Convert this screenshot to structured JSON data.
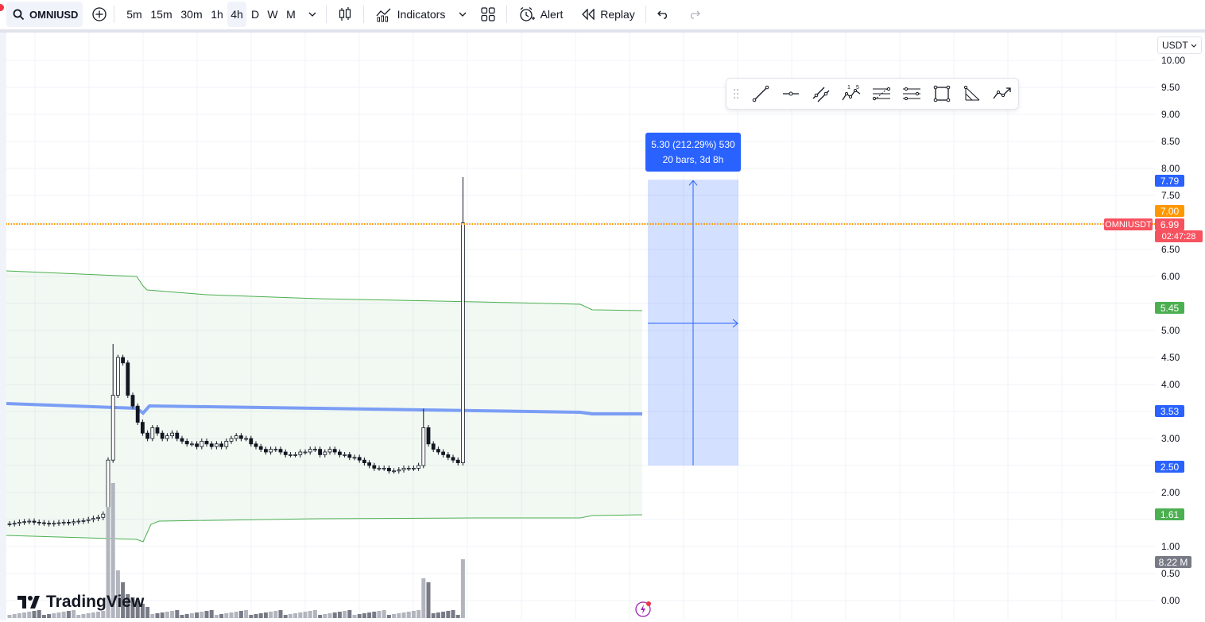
{
  "toolbar": {
    "symbol": "OMNIUSD",
    "intervals": [
      "5m",
      "15m",
      "30m",
      "1h",
      "4h",
      "D",
      "W",
      "M"
    ],
    "active_interval": "4h",
    "indicators_label": "Indicators",
    "alert_label": "Alert",
    "replay_label": "Replay"
  },
  "price_axis": {
    "currency": "USDT",
    "labels": [
      "10.00",
      "9.50",
      "9.00",
      "8.50",
      "8.00",
      "7.50",
      "6.50",
      "6.00",
      "5.00",
      "4.50",
      "4.00",
      "3.00",
      "2.00",
      "1.00",
      "0.50",
      "0.00"
    ],
    "tags": [
      {
        "value": "7.79",
        "color": "#2962ff"
      },
      {
        "value": "7.00",
        "color": "#ff9800"
      },
      {
        "value": "6.99",
        "color": "#f7525f"
      },
      {
        "value": "5.45",
        "color": "#4caf50"
      },
      {
        "value": "3.53",
        "color": "#2962ff"
      },
      {
        "value": "2.50",
        "color": "#2962ff"
      },
      {
        "value": "1.61",
        "color": "#4caf50"
      },
      {
        "value": "8.22 M",
        "color": "#787b86"
      }
    ],
    "countdown": "02:47:28"
  },
  "symbol_tag": "OMNIUSDT",
  "measure": {
    "line1": "5.30 (212.29%) 530",
    "line2": "20 bars, 3d 8h"
  },
  "logo_text": "TradingView",
  "colors": {
    "up": "#ffffff",
    "down": "#131722",
    "band": "#4caf50",
    "basis": "#2962ff",
    "hline": "#ff9800",
    "measure": "#2962ff"
  },
  "chart_data": {
    "type": "candlestick",
    "title": "",
    "xlabel": "",
    "ylabel": "",
    "ylim": [
      0,
      10
    ],
    "series_close": [
      1.42,
      1.43,
      1.45,
      1.46,
      1.47,
      1.45,
      1.44,
      1.43,
      1.42,
      1.43,
      1.44,
      1.45,
      1.44,
      1.46,
      1.47,
      1.48,
      1.5,
      1.52,
      1.54,
      1.6,
      2.6,
      3.8,
      4.5,
      4.4,
      3.8,
      3.6,
      3.3,
      3.1,
      3.0,
      3.2,
      3.1,
      3.0,
      3.05,
      3.1,
      3.0,
      2.95,
      2.9,
      2.9,
      2.85,
      2.95,
      2.9,
      2.85,
      2.9,
      2.85,
      2.95,
      3.0,
      3.05,
      3.0,
      3.0,
      2.9,
      2.85,
      2.8,
      2.75,
      2.8,
      2.8,
      2.75,
      2.7,
      2.7,
      2.7,
      2.75,
      2.75,
      2.8,
      2.8,
      2.7,
      2.75,
      2.8,
      2.75,
      2.7,
      2.7,
      2.65,
      2.65,
      2.6,
      2.55,
      2.5,
      2.45,
      2.45,
      2.45,
      2.4,
      2.4,
      2.42,
      2.45,
      2.45,
      2.45,
      2.5,
      3.2,
      2.9,
      2.8,
      2.75,
      2.7,
      2.65,
      2.6,
      2.55,
      6.99
    ],
    "volume_peak": "8.22 M",
    "bands": {
      "upper_end": 5.45,
      "basis_end": 3.53,
      "lower_end": 1.61
    },
    "horizontal_line": 7.0,
    "measure": {
      "from": 2.5,
      "to": 7.79,
      "change": "5.30 (212.29%) 530",
      "span": "20 bars, 3d 8h"
    }
  }
}
